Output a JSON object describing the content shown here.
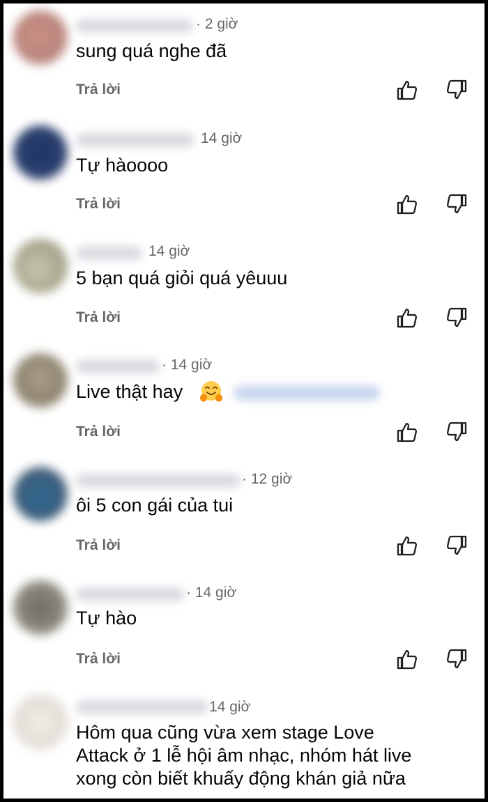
{
  "reply_label": "Trả lời",
  "comments": [
    {
      "time": "· 2 giờ",
      "text": "sung quá nghe đã"
    },
    {
      "time": "14 giờ",
      "text": "Tự hàoooo"
    },
    {
      "time": "14 giờ",
      "text": "5 bạn quá giỏi quá yêuuu"
    },
    {
      "time": "· 14 giờ",
      "text": "Live thật hay"
    },
    {
      "time": "· 12 giờ",
      "text": "ôi 5 con gái của tui"
    },
    {
      "time": "· 14 giờ",
      "text": "Tự hào"
    },
    {
      "time": "14 giờ",
      "text_lines": [
        "Hôm qua cũng vừa xem stage Love",
        "Attack ở 1 lễ hội âm nhạc, nhóm hát live",
        "xong còn biết khuấy động khán giả nữa"
      ]
    }
  ],
  "icons": {
    "like": "thumbs-up-icon",
    "dislike": "thumbs-down-icon",
    "emoji": "hugging-face-icon"
  }
}
